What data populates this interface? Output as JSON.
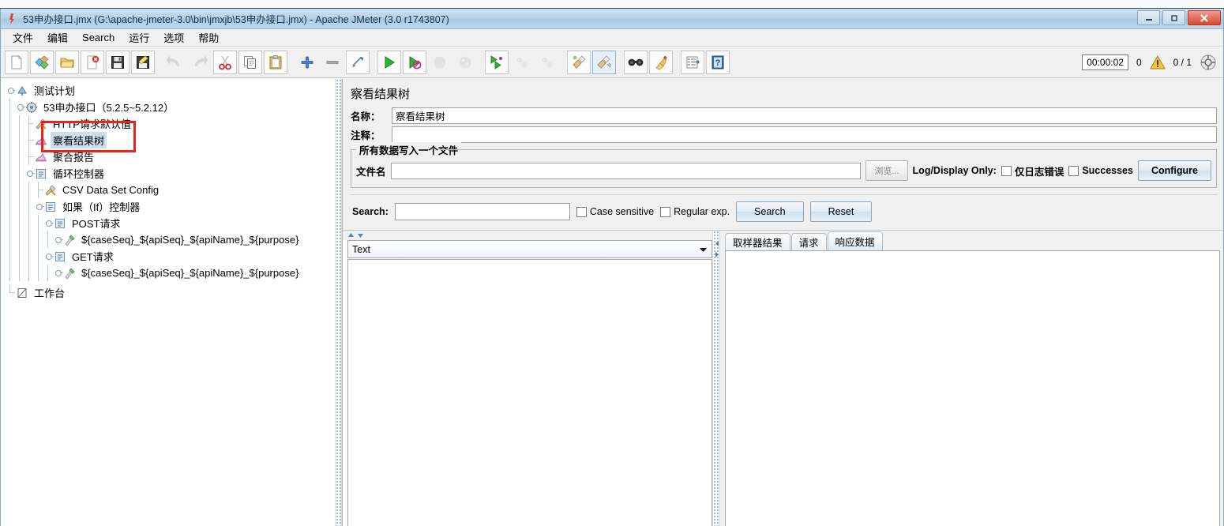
{
  "window": {
    "title": "53申办接口.jmx (G:\\apache-jmeter-3.0\\bin\\jmxjb\\53申办接口.jmx) - Apache JMeter (3.0 r1743807)",
    "minimize_label": "—",
    "maximize_label": "❐",
    "close_label": "✕"
  },
  "menu": {
    "items": [
      {
        "label": "文件"
      },
      {
        "label": "编辑"
      },
      {
        "label": "Search"
      },
      {
        "label": "运行"
      },
      {
        "label": "选项"
      },
      {
        "label": "帮助"
      }
    ]
  },
  "toolbar": {
    "buttons": [
      {
        "name": "new-icon",
        "title": "新建"
      },
      {
        "name": "templates-icon",
        "title": "模板"
      },
      {
        "name": "open-icon",
        "title": "打开"
      },
      {
        "name": "close-file-icon",
        "title": "关闭"
      },
      {
        "name": "save-icon",
        "title": "保存"
      },
      {
        "name": "save-as-icon",
        "title": "另存为"
      },
      {
        "name": "undo-icon",
        "title": "撤销"
      },
      {
        "name": "redo-icon",
        "title": "重做"
      },
      {
        "name": "cut-icon",
        "title": "剪切"
      },
      {
        "name": "copy-icon",
        "title": "复制"
      },
      {
        "name": "paste-icon",
        "title": "粘贴"
      },
      {
        "name": "expand-all-icon",
        "title": "展开全部"
      },
      {
        "name": "collapse-all-icon",
        "title": "折叠全部"
      },
      {
        "name": "toggle-icon",
        "title": "切换"
      },
      {
        "name": "start-icon",
        "title": "启动"
      },
      {
        "name": "start-no-pauses-icon",
        "title": "无暂停启动"
      },
      {
        "name": "stop-icon",
        "title": "停止"
      },
      {
        "name": "shutdown-icon",
        "title": "关闭"
      },
      {
        "name": "start-remote-all-icon",
        "title": "远程启动全部"
      },
      {
        "name": "stop-remote-all-icon",
        "title": "远程停止全部"
      },
      {
        "name": "shutdown-remote-all-icon",
        "title": "远程关闭全部"
      },
      {
        "name": "clear-icon",
        "title": "清除"
      },
      {
        "name": "clear-all-icon",
        "title": "清除全部"
      },
      {
        "name": "search-icon",
        "title": "查找"
      },
      {
        "name": "search-reset-icon",
        "title": "重置查找"
      },
      {
        "name": "function-helper-icon",
        "title": "函数助手"
      },
      {
        "name": "help-icon",
        "title": "帮助"
      }
    ],
    "timer": "00:00:02",
    "warning_count": "0",
    "thread_count": "0 / 1"
  },
  "tree": {
    "nodes": [
      {
        "label": "测试计划",
        "icon": "test-plan-icon",
        "depth": 0,
        "selected": false,
        "expander": true
      },
      {
        "label": "53申办接口（5.2.5~5.2.12）",
        "icon": "thread-group-icon",
        "depth": 1,
        "selected": false,
        "expander": true
      },
      {
        "label": "HTTP请求默认值",
        "icon": "config-element-icon",
        "depth": 2,
        "selected": false,
        "expander": false
      },
      {
        "label": "察看结果树",
        "icon": "listener-icon",
        "depth": 2,
        "selected": true,
        "expander": false
      },
      {
        "label": "聚合报告",
        "icon": "listener-icon",
        "depth": 2,
        "selected": false,
        "expander": false
      },
      {
        "label": "循环控制器",
        "icon": "controller-icon",
        "depth": 2,
        "selected": false,
        "expander": true
      },
      {
        "label": "CSV Data Set Config",
        "icon": "config-element-icon",
        "depth": 3,
        "selected": false,
        "expander": false
      },
      {
        "label": "如果（If）控制器",
        "icon": "controller-icon",
        "depth": 3,
        "selected": false,
        "expander": true
      },
      {
        "label": "POST请求",
        "icon": "controller-icon",
        "depth": 4,
        "selected": false,
        "expander": true
      },
      {
        "label": "${caseSeq}_${apiSeq}_${apiName}_${purpose}",
        "icon": "sampler-icon",
        "depth": 5,
        "selected": false,
        "expander": true
      },
      {
        "label": "GET请求",
        "icon": "controller-icon",
        "depth": 4,
        "selected": false,
        "expander": true
      },
      {
        "label": "${caseSeq}_${apiSeq}_${apiName}_${purpose}",
        "icon": "sampler-icon",
        "depth": 5,
        "selected": false,
        "expander": true
      },
      {
        "label": "工作台",
        "icon": "workbench-icon",
        "depth": 0,
        "selected": false,
        "expander": false
      }
    ],
    "highlight_color": "#e8231a"
  },
  "panel": {
    "title": "察看结果树",
    "name_label": "名称：",
    "name_value": "察看结果树",
    "comment_label": "注释：",
    "comment_value": "",
    "file_group_legend": "所有数据写入一个文件",
    "filename_label": "文件名",
    "filename_value": "",
    "browse_button": "浏览...",
    "log_display_label": "Log/Display Only:",
    "errors_only_label": "仅日志错误",
    "errors_only_checked": false,
    "successes_label": "Successes",
    "successes_checked": false,
    "configure_button": "Configure"
  },
  "search": {
    "label": "Search:",
    "value": "",
    "case_sensitive_label": "Case sensitive",
    "case_sensitive_checked": false,
    "regular_exp_label": "Regular exp.",
    "regular_exp_checked": false,
    "search_button": "Search",
    "reset_button": "Reset"
  },
  "results": {
    "renderer_selected": "Text",
    "tabs": [
      {
        "label": "取样器结果",
        "selected": false
      },
      {
        "label": "请求",
        "selected": false
      },
      {
        "label": "响应数据",
        "selected": true
      }
    ],
    "tree_content": "",
    "detail_content": ""
  }
}
